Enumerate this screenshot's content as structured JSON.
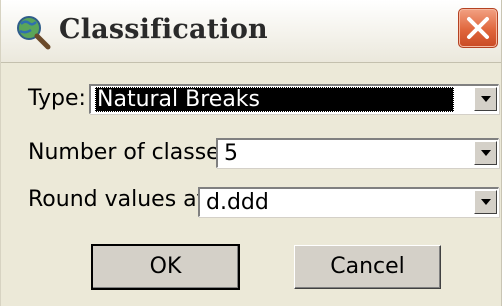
{
  "window": {
    "title": "Classification",
    "icon": "globe-magnifier-icon",
    "close_icon": "close-icon"
  },
  "fields": {
    "type": {
      "label": "Type:",
      "value": "Natural Breaks"
    },
    "classes": {
      "label": "Number of classes:",
      "value": "5"
    },
    "round": {
      "label": "Round values at:",
      "value": "d.ddd"
    }
  },
  "buttons": {
    "ok": "OK",
    "cancel": "Cancel"
  },
  "colors": {
    "close_button": "#e0663c",
    "selection": "#000000",
    "face": "#ece9d8"
  }
}
